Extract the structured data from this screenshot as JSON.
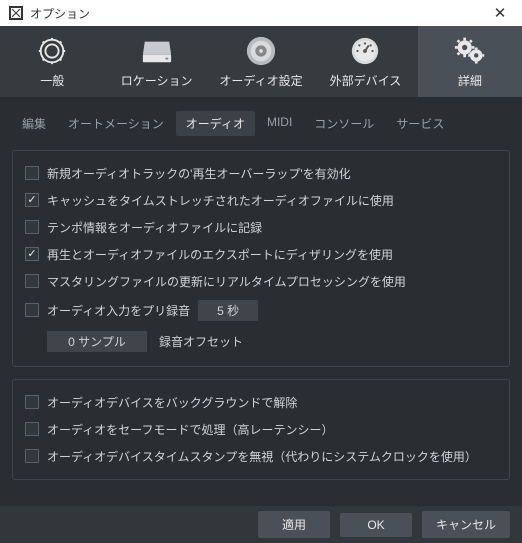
{
  "window": {
    "title": "オプション"
  },
  "toolbar": {
    "items": [
      {
        "label": "一般"
      },
      {
        "label": "ロケーション"
      },
      {
        "label": "オーディオ設定"
      },
      {
        "label": "外部デバイス"
      },
      {
        "label": "詳細"
      }
    ]
  },
  "tabs": {
    "items": [
      {
        "label": "編集"
      },
      {
        "label": "オートメーション"
      },
      {
        "label": "オーディオ"
      },
      {
        "label": "MIDI"
      },
      {
        "label": "コンソール"
      },
      {
        "label": "サービス"
      }
    ]
  },
  "group1": {
    "c0": {
      "label": "新規オーディオトラックの'再生オーバーラップ'を有効化",
      "checked": false
    },
    "c1": {
      "label": "キャッシュをタイムストレッチされたオーディオファイルに使用",
      "checked": true
    },
    "c2": {
      "label": "テンポ情報をオーディオファイルに記録",
      "checked": false
    },
    "c3": {
      "label": "再生とオーディオファイルのエクスポートにディザリングを使用",
      "checked": true
    },
    "c4": {
      "label": "マスタリングファイルの更新にリアルタイムプロセッシングを使用",
      "checked": false
    },
    "prerecord": {
      "cb_checked": false,
      "label": "オーディオ入力をプリ録音",
      "value": "5 秒"
    },
    "sample": {
      "value": "0 サンプル",
      "label": "録音オフセット"
    }
  },
  "group2": {
    "c0": {
      "label": "オーディオデバイスをバックグラウンドで解除",
      "checked": false
    },
    "c1": {
      "label": "オーディオをセーフモードで処理（高レーテンシー）",
      "checked": false
    },
    "c2": {
      "label": "オーディオデバイスタイムスタンプを無視（代わりにシステムクロックを使用）",
      "checked": false
    }
  },
  "footer": {
    "apply": "適用",
    "ok": "OK",
    "cancel": "キャンセル"
  }
}
